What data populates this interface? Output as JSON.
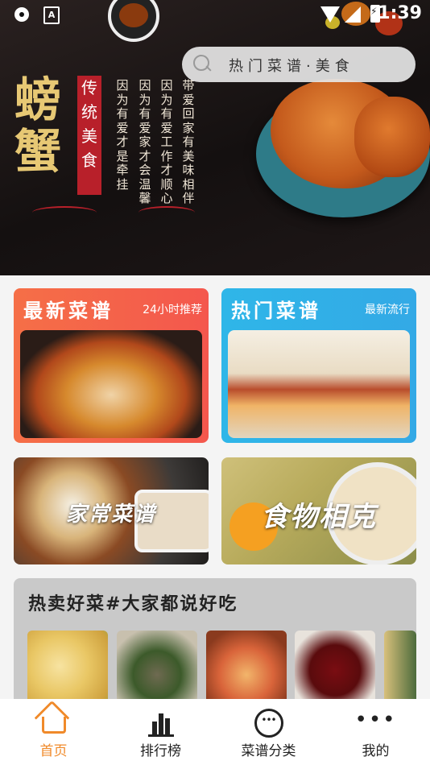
{
  "status_bar": {
    "time": "1:39"
  },
  "search": {
    "placeholder": "热门菜谱·美食"
  },
  "banner": {
    "title": "螃蟹",
    "badge": [
      "传",
      "统",
      "美",
      "食"
    ],
    "columns": [
      "因为有爱才是牵挂",
      "因为有爱家才会温馨",
      "因为有爱工作才顺心",
      "带爱回家有美味相伴"
    ]
  },
  "cards": {
    "latest": {
      "title": "最新菜谱",
      "subtitle": "24小时推荐"
    },
    "hot": {
      "title": "热门菜谱",
      "subtitle": "最新流行"
    },
    "home_cooking": {
      "title": "家常菜谱"
    },
    "food_conflicts": {
      "title": "食物相克"
    }
  },
  "section": {
    "title": "热卖好菜#大家都说好吃"
  },
  "nav": {
    "items": [
      {
        "label": "首页",
        "active": true
      },
      {
        "label": "排行榜",
        "active": false
      },
      {
        "label": "菜谱分类",
        "active": false
      },
      {
        "label": "我的",
        "active": false
      }
    ]
  },
  "colors": {
    "accent": "#f08a2a",
    "latest_bg": "#f4574d",
    "hot_bg": "#33a9e6"
  }
}
